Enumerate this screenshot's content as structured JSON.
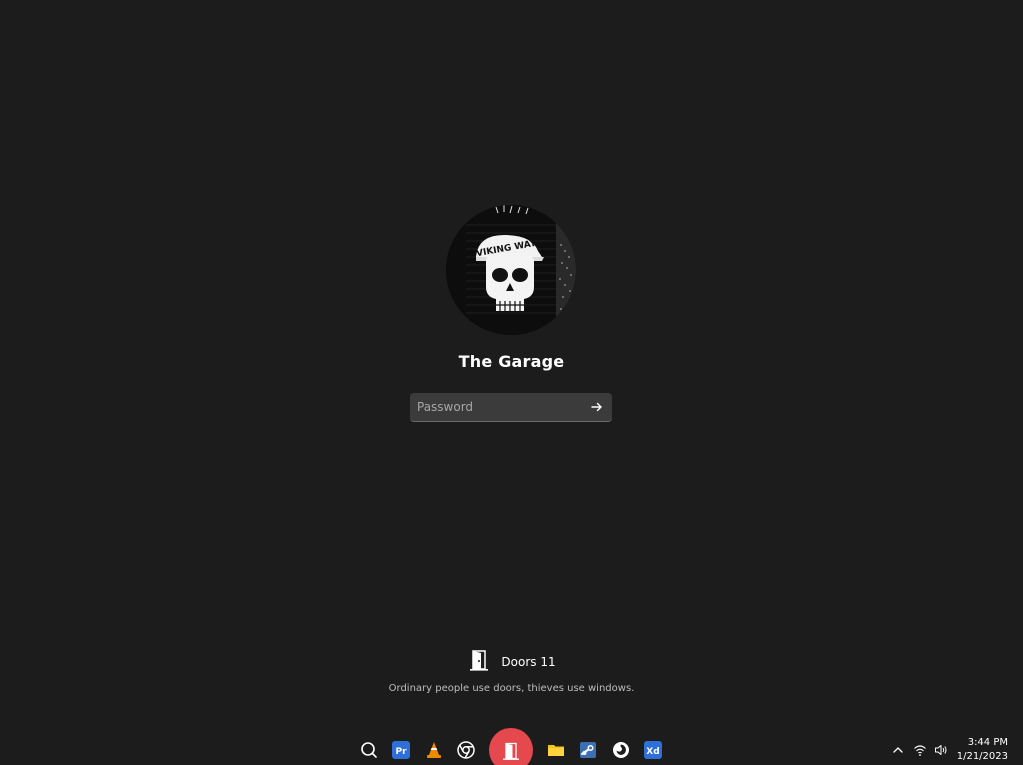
{
  "login": {
    "username": "The Garage",
    "password_placeholder": "Password",
    "avatar_text": "VIKING WAY"
  },
  "brand": {
    "name": "Doors 11",
    "tagline": "Ordinary people use doors, thieves use windows."
  },
  "taskbar": {
    "apps": [
      {
        "name": "search-icon"
      },
      {
        "name": "premiere-pro-icon",
        "label": "Pr",
        "color": "#2e6fd8"
      },
      {
        "name": "vlc-icon",
        "color": "#f08a00"
      },
      {
        "name": "chrome-icon"
      },
      {
        "name": "doors-start-icon",
        "color": "#e5484d"
      },
      {
        "name": "file-explorer-icon",
        "color": "#f5c518"
      },
      {
        "name": "steam-icon",
        "color": "#3d6fb3"
      },
      {
        "name": "firefox-icon"
      },
      {
        "name": "adobe-xd-icon",
        "label": "Xd",
        "color": "#2e6fd8"
      }
    ],
    "tray": {
      "chevron": "chevron-up-icon",
      "wifi": "wifi-icon",
      "volume": "volume-icon"
    },
    "clock": {
      "time": "3:44 PM",
      "date": "1/21/2023"
    }
  }
}
